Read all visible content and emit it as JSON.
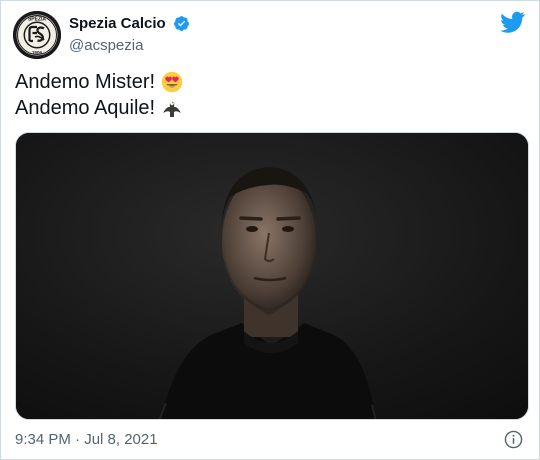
{
  "author": {
    "display_name": "Spezia Calcio",
    "handle": "@acspezia",
    "avatar_text": "SPEZIA",
    "avatar_year": "1906",
    "verified_icon": "verified-badge-icon"
  },
  "tweet": {
    "line1": "Andemo Mister!",
    "line2": "Andemo Aquile!",
    "line1_emoji": "heart-eyes-emoji",
    "line2_emoji": "eagle-emoji"
  },
  "media": {
    "type": "video-thumbnail",
    "description_icon": "video-still"
  },
  "footer": {
    "timestamp": "9:34 PM · Jul 8, 2021",
    "info_icon": "info-icon"
  },
  "colors": {
    "twitter_blue": "#1d9bf0",
    "text_primary": "#0f1419",
    "text_secondary": "#536471",
    "border": "#cfd9de"
  }
}
